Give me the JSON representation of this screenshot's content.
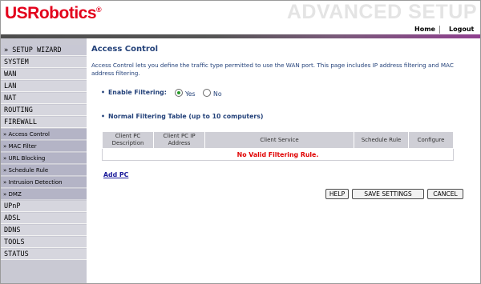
{
  "header": {
    "logo_text": "USRobotics",
    "logo_reg": "®",
    "banner": "ADVANCED SETUP",
    "nav": {
      "home": "Home",
      "logout": "Logout"
    }
  },
  "sidebar": {
    "items": [
      {
        "label": "» SETUP WIZARD"
      },
      {
        "label": "SYSTEM"
      },
      {
        "label": "WAN"
      },
      {
        "label": "LAN"
      },
      {
        "label": "NAT"
      },
      {
        "label": "ROUTING"
      },
      {
        "label": "FIREWALL"
      },
      {
        "label": "» Access Control"
      },
      {
        "label": "» MAC Filter"
      },
      {
        "label": "» URL Blocking"
      },
      {
        "label": "» Schedule Rule"
      },
      {
        "label": "» Intrusion Detection"
      },
      {
        "label": "» DMZ"
      },
      {
        "label": "UPnP"
      },
      {
        "label": "ADSL"
      },
      {
        "label": "DDNS"
      },
      {
        "label": "TOOLS"
      },
      {
        "label": "STATUS"
      }
    ]
  },
  "main": {
    "title": "Access Control",
    "description": "Access Control lets you define the traffic type permitted to use the WAN port. This page includes IP address filtering and MAC address filtering.",
    "bullet": "•",
    "enable_filtering_label": "Enable Filtering:",
    "enable_filtering_value": "Yes",
    "radio_yes": "Yes",
    "radio_no": "No",
    "table_heading": "Normal Filtering Table (up to 10 computers)",
    "table": {
      "columns": [
        "Client PC Description",
        "Client PC IP Address",
        "Client Service",
        "Schedule Rule",
        "Configure"
      ],
      "empty_message": "No Valid Filtering Rule."
    },
    "add_pc": "Add PC",
    "buttons": {
      "help": "HELP",
      "save": "SAVE SETTINGS",
      "cancel": "CANCEL"
    }
  },
  "colors": {
    "brand_red": "#e3001b",
    "heading_blue": "#24427a",
    "sidebar_bg": "#c9c9d3",
    "sidebar_sub_bg": "#b4b4c6",
    "error_red": "#e00000",
    "link_blue": "#1a1a9a"
  }
}
